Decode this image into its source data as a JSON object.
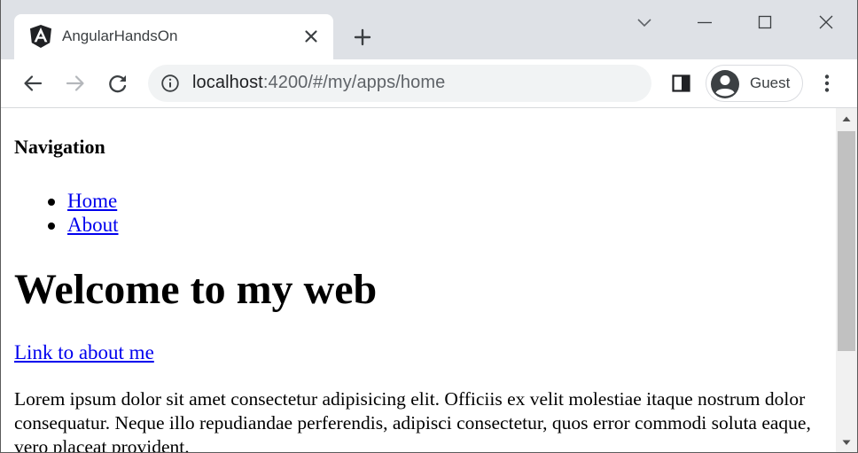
{
  "browser": {
    "tab": {
      "title": "AngularHandsOn",
      "favicon": "angular-logo-icon",
      "close_icon": "close-icon"
    },
    "new_tab_icon": "plus-icon",
    "window_controls": [
      "tab-search-icon",
      "minimize-icon",
      "maximize-icon",
      "close-icon"
    ],
    "toolbar": {
      "back_icon": "arrow-left-icon",
      "forward_icon": "arrow-right-icon",
      "reload_icon": "reload-icon",
      "site_info_icon": "info-icon",
      "url_host": "localhost",
      "url_rest": ":4200/#/my/apps/home",
      "side_panel_icon": "side-panel-icon",
      "profile_label": "Guest",
      "profile_icon": "avatar-icon",
      "menu_icon": "kebab-menu-icon"
    }
  },
  "page": {
    "nav_heading": "Navigation",
    "nav_items": [
      {
        "label": "Home"
      },
      {
        "label": "About"
      }
    ],
    "title": "Welcome to my web",
    "about_link": "Link to about me",
    "paragraph": "Lorem ipsum dolor sit amet consectetur adipisicing elit. Officiis ex velit molestiae itaque nostrum dolor consequatur. Neque illo repudiandae perferendis, adipisci consectetur, quos error commodi soluta eaque, vero placeat provident."
  },
  "colors": {
    "tabstrip": "#dee1e6",
    "omnibox": "#f1f3f4",
    "link": "#0000ee",
    "scroll_thumb": "#c1c1c1"
  }
}
